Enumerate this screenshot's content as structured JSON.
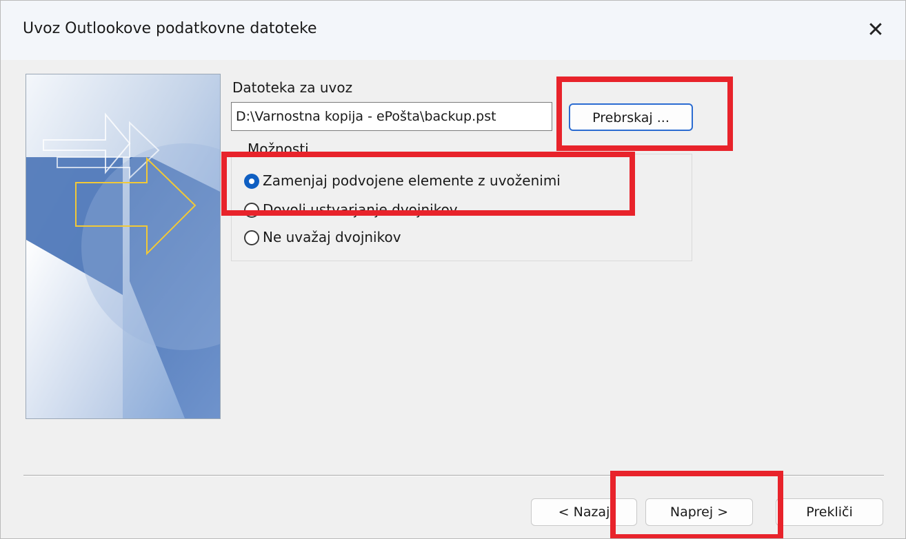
{
  "dialog": {
    "title": "Uvoz Outlookove podatkovne datoteke",
    "close_glyph": "✕",
    "close_icon": "close-icon"
  },
  "file": {
    "label": "Datoteka za uvoz",
    "value": "D:\\Varnostna kopija - ePošta\\backup.pst",
    "browse_label": "Prebrskaj ..."
  },
  "options": {
    "legend": "Možnosti",
    "items": [
      {
        "label": "Zamenjaj podvojene elemente z uvoženimi",
        "checked": true
      },
      {
        "label": "Dovoli ustvarjanje dvojnikov",
        "checked": false
      },
      {
        "label": "Ne uvažaj dvojnikov",
        "checked": false
      }
    ]
  },
  "buttons": {
    "back": "< Nazaj",
    "next": "Naprej >",
    "cancel": "Prekliči"
  },
  "colors": {
    "highlight": "#e8232b",
    "radio_checked": "#0f5fc2",
    "focus_border": "#2a6bd1"
  }
}
